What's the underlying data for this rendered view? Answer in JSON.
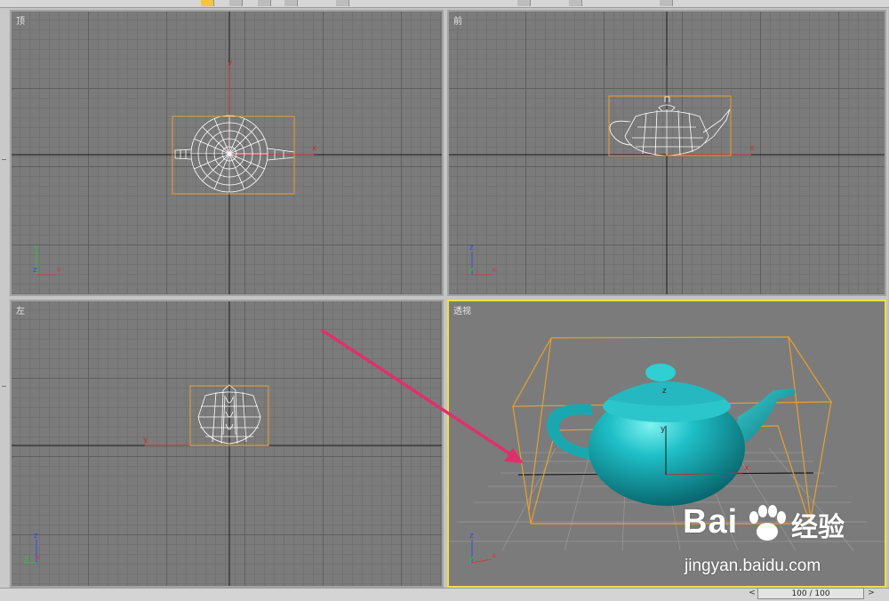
{
  "viewports": {
    "top": {
      "label": "顶"
    },
    "front": {
      "label": "前"
    },
    "left": {
      "label": "左"
    },
    "perspective": {
      "label": "透视"
    }
  },
  "axis_labels": {
    "x": "x",
    "y": "y",
    "z": "z"
  },
  "timeline": {
    "frame_display": "100 / 100",
    "prev_icon": "<",
    "next_icon": ">"
  },
  "watermark": {
    "brand": "Bai",
    "brand_cn": "经验",
    "url": "jingyan.baidu.com"
  },
  "colors": {
    "viewport_bg": "#7b7b7b",
    "selection_box": "#e8a030",
    "active_border": "#f0e040",
    "teapot": "#1fb8c0",
    "arrow": "#e0306a",
    "axis_x": "#d04040",
    "axis_y": "#30c040",
    "axis_z": "#3050e0"
  }
}
